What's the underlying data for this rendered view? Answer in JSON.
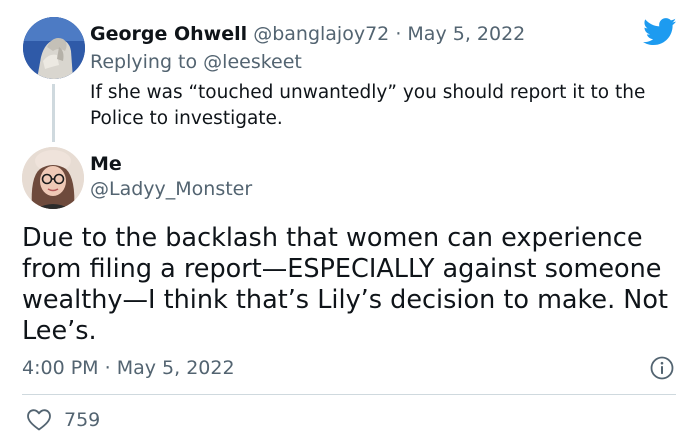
{
  "parent_tweet": {
    "avatar_icon": "statue-avatar",
    "author_name": "George Ohwell",
    "author_handle": "@banglajoy72",
    "separator": "·",
    "date": "May 5, 2022",
    "replying_prefix": "Replying to",
    "replying_to": "@leeskeet",
    "text": "If she was “touched unwantedly” you should report it to the Police to investigate."
  },
  "brand": {
    "logo_icon": "twitter-bird-icon",
    "color": "#1d9bf0"
  },
  "tweet": {
    "avatar_icon": "user-avatar",
    "author_name": "Me",
    "author_handle": "@Ladyy_Monster",
    "text": "Due to the backlash that women can experience from filing a report—ESPECIALLY against someone wealthy—I think that’s Lily’s decision to make. Not Lee’s.",
    "time": "4:00 PM",
    "separator": "·",
    "date": "May 5, 2022",
    "info_icon": "info-icon",
    "like_icon": "heart-icon",
    "like_count": "759"
  }
}
